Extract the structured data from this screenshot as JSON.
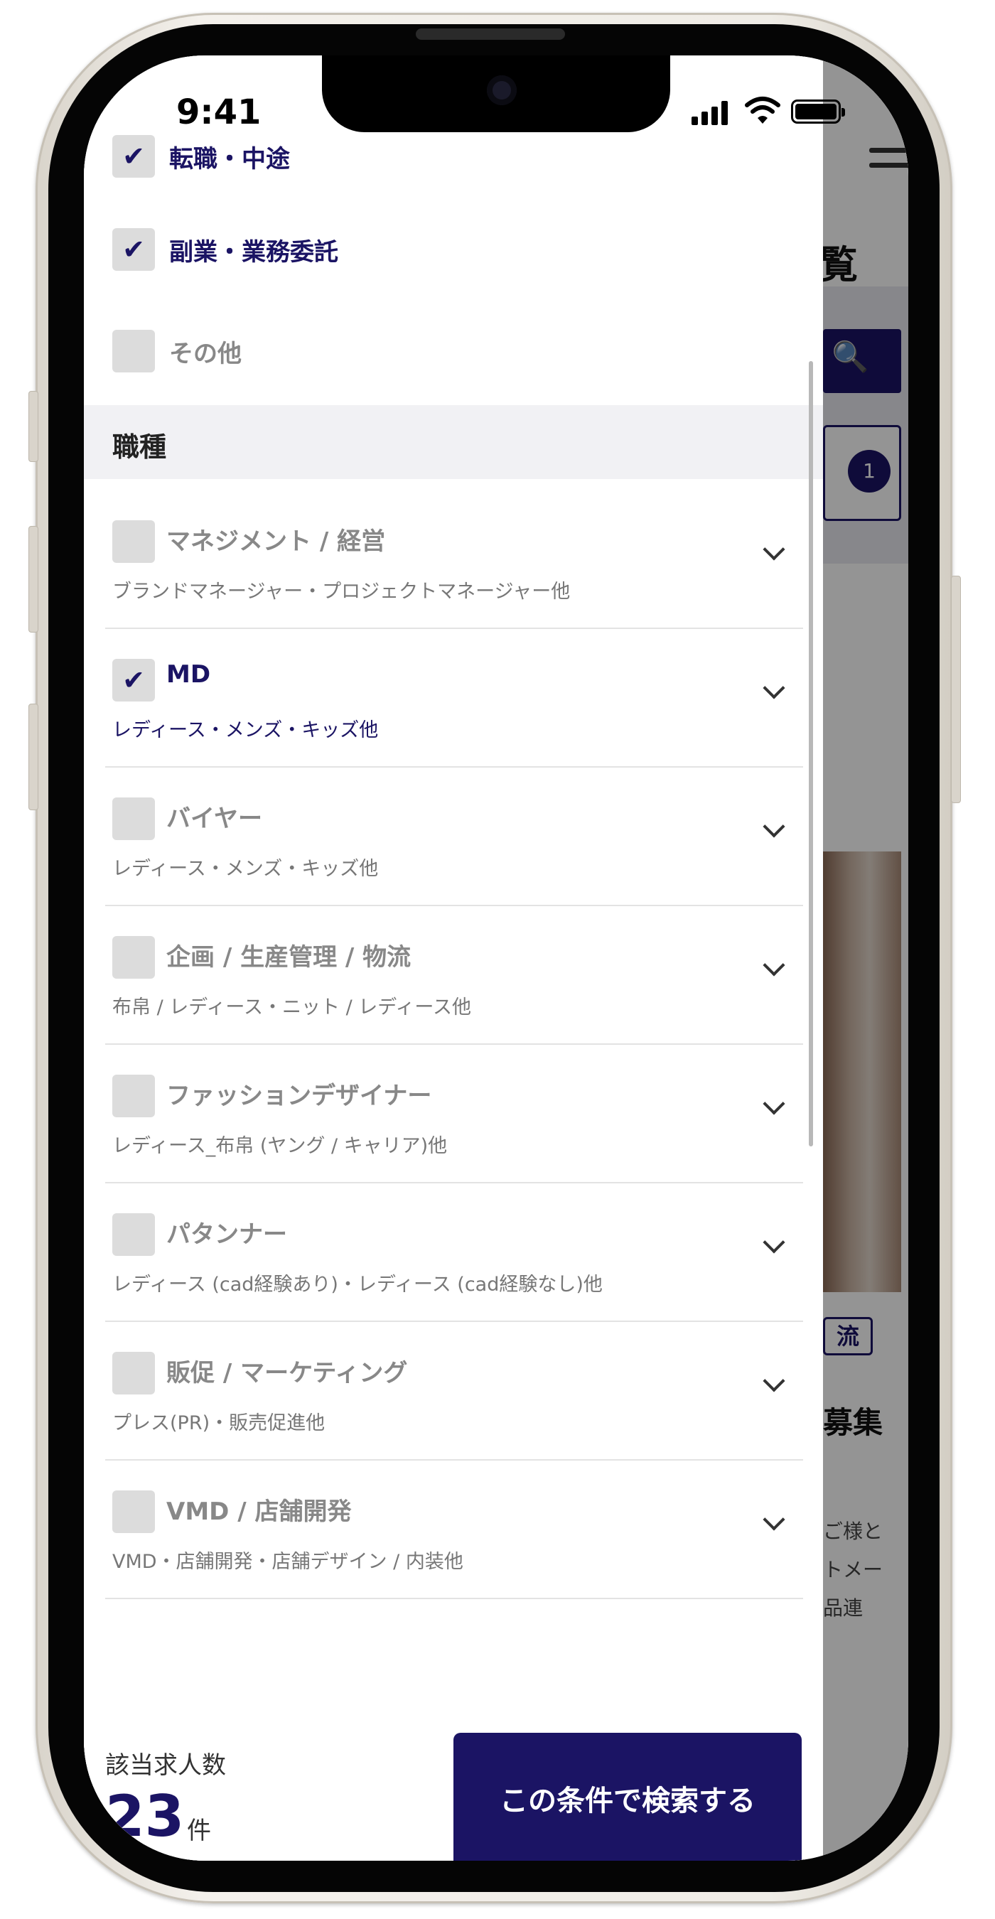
{
  "status_bar": {
    "time": "9:41"
  },
  "background_page": {
    "title_fragment": "覧",
    "search_icon": "search-icon",
    "filter_count": "1",
    "tag_fragment": "流",
    "recruit_fragment": "募集",
    "desc_fragment": "ご様と\nトメー\n品連"
  },
  "employment_types": [
    {
      "label": "転職・中途",
      "checked": true
    },
    {
      "label": "副業・業務委託",
      "checked": true
    },
    {
      "label": "その他",
      "checked": false
    }
  ],
  "occupation_section": {
    "heading": "職種"
  },
  "occupations": [
    {
      "title": "マネジメント / 経営",
      "sub": "ブランドマネージャー・プロジェクトマネージャー他",
      "checked": false
    },
    {
      "title": "MD",
      "sub": "レディース・メンズ・キッズ他",
      "checked": true
    },
    {
      "title": "バイヤー",
      "sub": "レディース・メンズ・キッズ他",
      "checked": false
    },
    {
      "title": "企画 / 生産管理 / 物流",
      "sub": "布帛 / レディース・ニット / レディース他",
      "checked": false
    },
    {
      "title": "ファッションデザイナー",
      "sub": "レディース_布帛 (ヤング / キャリア)他",
      "checked": false
    },
    {
      "title": "パタンナー",
      "sub": "レディース (cad経験あり)・レディース (cad経験なし)他",
      "checked": false
    },
    {
      "title": "販促 / マーケティング",
      "sub": "プレス(PR)・販売促進他",
      "checked": false
    },
    {
      "title": "VMD / 店舗開発",
      "sub": "VMD・店舗開発・店舗デザイン / 内装他",
      "checked": false
    }
  ],
  "footer": {
    "result_label": "該当求人数",
    "result_count": "23",
    "result_unit": "件",
    "search_button": "この条件で検索する"
  },
  "colors": {
    "accent": "#1b1464",
    "checkbox": "#dcdcdc",
    "section_bg": "#f1f1f4"
  }
}
